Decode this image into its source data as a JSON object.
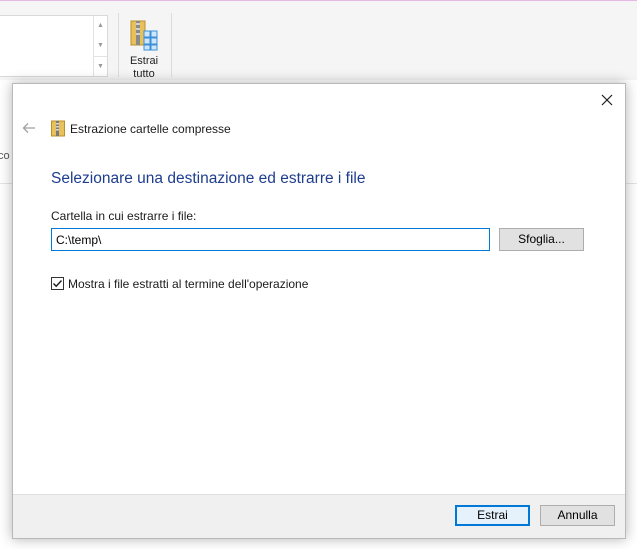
{
  "background": {
    "ribbon": {
      "extract_all_label_line1": "Estrai",
      "extract_all_label_line2": "tutto",
      "scroll_up": "▲",
      "scroll_down": "▼"
    },
    "left_partial_text": "co"
  },
  "dialog": {
    "title": "Estrazione cartelle compresse",
    "close_glyph": "✕",
    "back_glyph": "←",
    "heading": "Selezionare una destinazione ed estrarre i file",
    "destination_label": "Cartella in cui estrarre i file:",
    "destination_value": "C:\\temp\\",
    "browse_label": "Sfoglia...",
    "show_files_checkbox": {
      "label": "Mostra i file estratti al termine dell'operazione",
      "checked": true
    },
    "extract_label": "Estrai",
    "cancel_label": "Annulla"
  },
  "colors": {
    "accent": "#0078d7",
    "heading": "#1e3d8f",
    "zip_folder": "#e8c15a"
  }
}
